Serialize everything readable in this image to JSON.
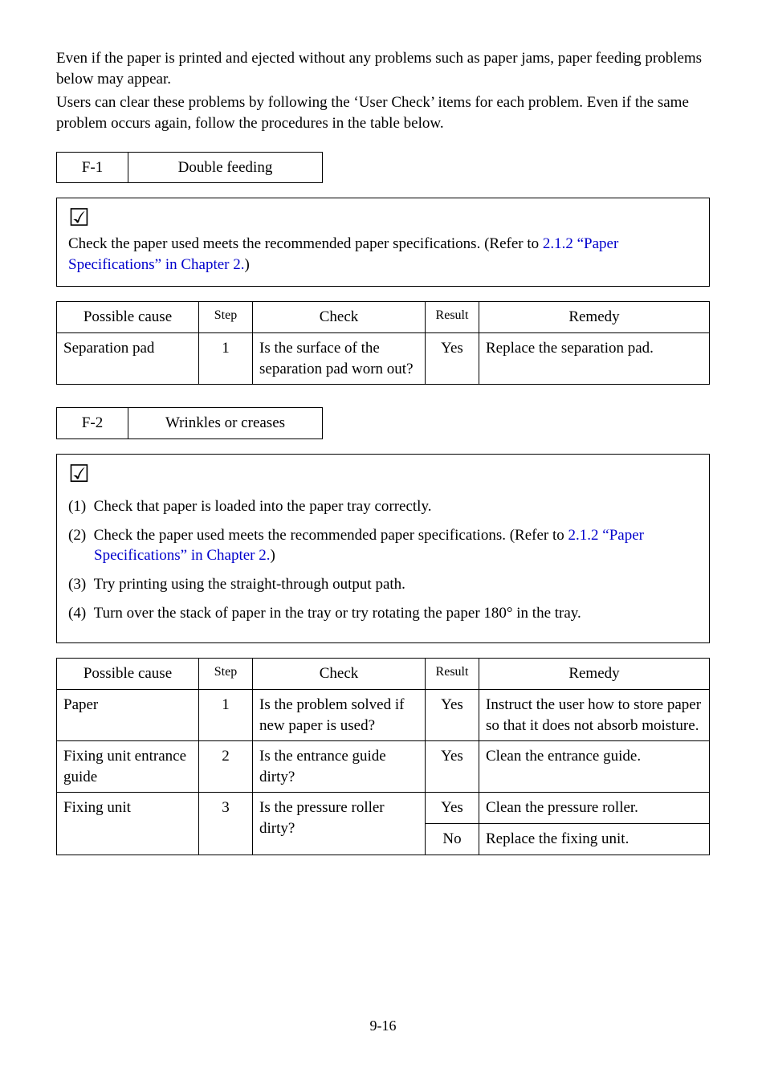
{
  "intro": {
    "p1": "Even if the paper is printed and ejected without any problems such as paper jams, paper feeding problems below may appear.",
    "p2": "Users can clear these problems by following the ‘User Check’ items for each problem.  Even if the same problem occurs again, follow the procedures in the table below."
  },
  "section1": {
    "code": "F-1",
    "title": "Double feeding",
    "check_text_before": "Check the paper used meets the recommended paper specifications. (Refer to ",
    "check_link": "2.1.2 “Paper Specifications” in Chapter 2.",
    "check_text_after": ")",
    "table": {
      "headers": {
        "cause": "Possible cause",
        "step": "Step",
        "check": "Check",
        "result": "Result",
        "remedy": "Remedy"
      },
      "rows": [
        {
          "cause": "Separation pad",
          "step": "1",
          "check": "Is the surface of the separation pad worn out?",
          "result": "Yes",
          "remedy": "Replace the separation pad."
        }
      ]
    }
  },
  "section2": {
    "code": "F-2",
    "title": "Wrinkles or creases",
    "check_items": [
      {
        "num": "(1)",
        "text": "Check that paper is loaded into the paper tray correctly."
      },
      {
        "num": "(2)",
        "before": "Check the paper used meets the recommended paper specifications. (Refer to ",
        "link": "2.1.2  “Paper Specifications” in Chapter 2.",
        "after": ")"
      },
      {
        "num": "(3)",
        "text": "Try printing using the straight-through output path."
      },
      {
        "num": "(4)",
        "text": "Turn over the stack of paper in the tray or try rotating the paper 180° in the tray."
      }
    ],
    "table": {
      "headers": {
        "cause": "Possible cause",
        "step": "Step",
        "check": "Check",
        "result": "Result",
        "remedy": "Remedy"
      },
      "rows": [
        {
          "cause": "Paper",
          "step": "1",
          "check": "Is the problem solved if new paper is used?",
          "result": "Yes",
          "remedy": "Instruct the user how to store paper so that it does not absorb moisture."
        },
        {
          "cause": "Fixing unit entrance guide",
          "step": "2",
          "check": "Is the entrance guide dirty?",
          "result": "Yes",
          "remedy": "Clean the entrance guide."
        },
        {
          "cause": "Fixing unit",
          "step": "3",
          "check": "Is the pressure roller dirty?",
          "result": "Yes",
          "remedy": "Clean the pressure roller."
        },
        {
          "result2": "No",
          "remedy2": "Replace the fixing unit."
        }
      ]
    }
  },
  "footer": "9-16"
}
